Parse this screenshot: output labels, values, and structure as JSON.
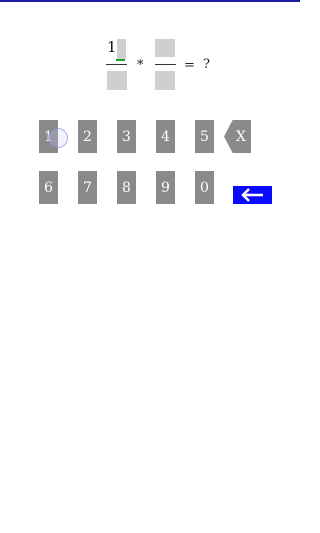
{
  "equation": {
    "numerator_1": "1",
    "operator": "*",
    "equals": "=",
    "result": "?"
  },
  "keypad": {
    "row1": [
      "1",
      "2",
      "3",
      "4",
      "5"
    ],
    "row2": [
      "6",
      "7",
      "8",
      "9",
      "0"
    ],
    "backspace_label": "X",
    "enter_icon": "arrow-left-icon"
  },
  "colors": {
    "key_bg": "#8a8a8a",
    "enter_bg": "#0a0aff",
    "cursor": "#1aa51a",
    "frac_box": "#cfcfcf",
    "top_rule": "#1a1aa6"
  }
}
